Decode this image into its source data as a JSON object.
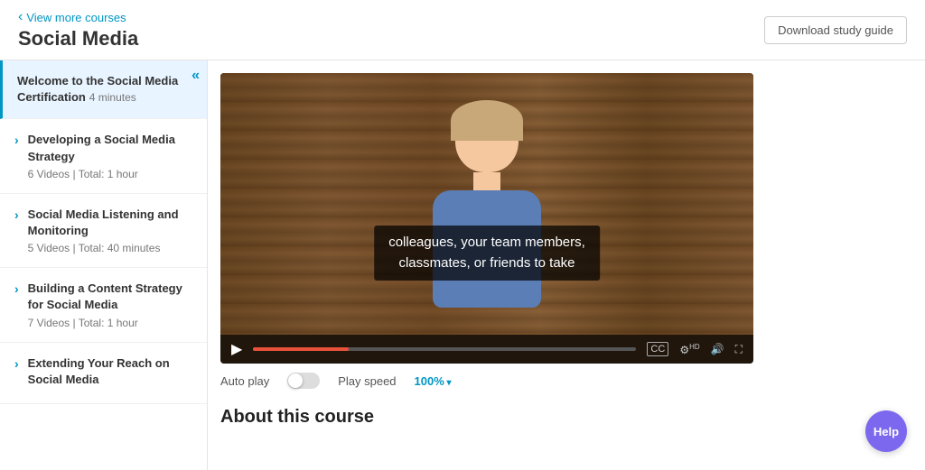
{
  "header": {
    "back_label": "View more courses",
    "title": "Social Media",
    "download_btn": "Download study guide"
  },
  "sidebar": {
    "collapse_icon": "«",
    "items": [
      {
        "id": "welcome",
        "title": "Welcome to the Social Media Certification",
        "meta": "4 minutes",
        "active": true,
        "expandable": false
      },
      {
        "id": "developing",
        "title": "Developing a Social Media Strategy",
        "meta": "6 Videos | Total: 1 hour",
        "active": false,
        "expandable": true
      },
      {
        "id": "listening",
        "title": "Social Media Listening and Monitoring",
        "meta": "5 Videos | Total: 40 minutes",
        "active": false,
        "expandable": true
      },
      {
        "id": "content",
        "title": "Building a Content Strategy for Social Media",
        "meta": "7 Videos | Total: 1 hour",
        "active": false,
        "expandable": true
      },
      {
        "id": "extending",
        "title": "Extending Your Reach on Social Media",
        "meta": "",
        "active": false,
        "expandable": true
      }
    ]
  },
  "video": {
    "subtitle_line1": "colleagues, your team members,",
    "subtitle_line2": "classmates, or friends to take",
    "progress_percent": 25
  },
  "video_options": {
    "autoplay_label": "Auto play",
    "playspeed_label": "Play speed",
    "playspeed_value": "100%"
  },
  "about": {
    "title": "About this course"
  },
  "help": {
    "label": "Help"
  }
}
